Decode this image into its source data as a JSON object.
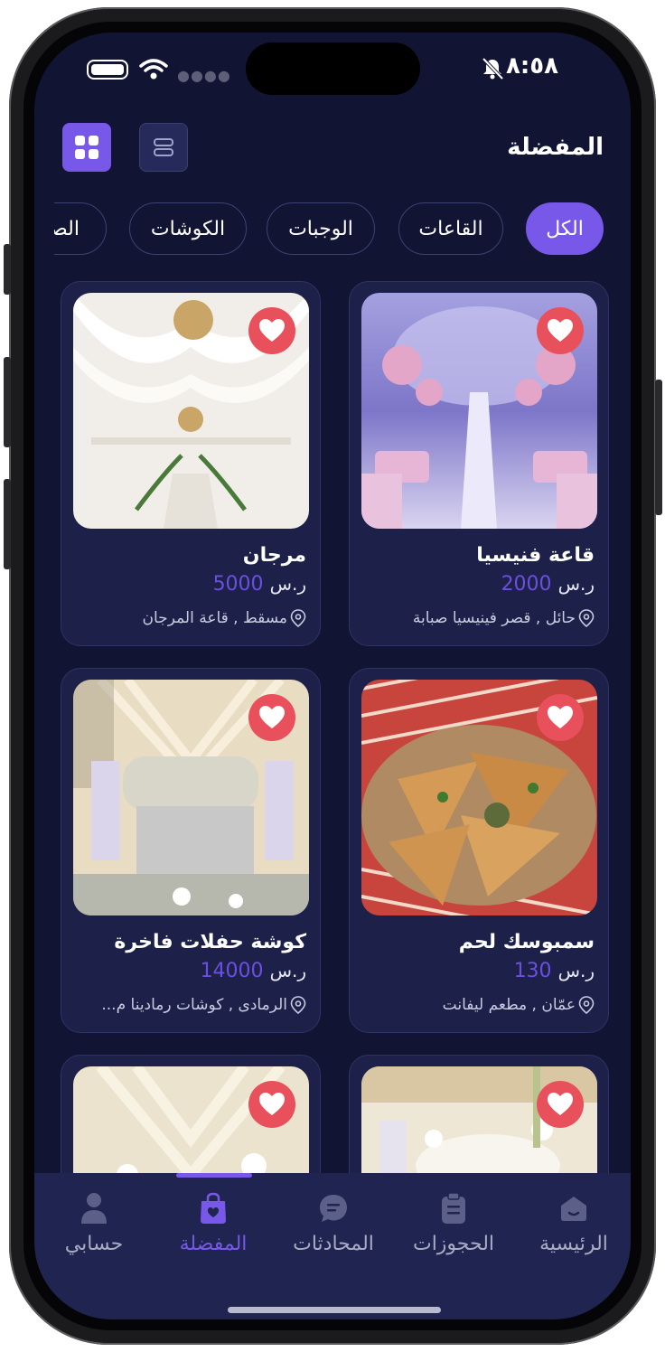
{
  "status": {
    "time": "٨:٥٨"
  },
  "header": {
    "title": "المفضلة"
  },
  "filters": [
    "الكل",
    "القاعات",
    "الوجبات",
    "الكوشات",
    "الصالات"
  ],
  "cards": [
    {
      "title": "قاعة فنيسيا",
      "price": "2000",
      "currency": "ر.س",
      "location": "حائل , قصر فينيسيا صبابة"
    },
    {
      "title": "مرجان",
      "price": "5000",
      "currency": "ر.س",
      "location": "مسقط , قاعة المرجان"
    },
    {
      "title": "سمبوسك لحم",
      "price": "130",
      "currency": "ر.س",
      "location": "عمّان , مطعم ليفانت"
    },
    {
      "title": "كوشة حفلات فاخرة",
      "price": "14000",
      "currency": "ر.س",
      "location": "الرمادى , كوشات رمادينا م..."
    }
  ],
  "nav": {
    "home": "الرئيسية",
    "bookings": "الحجوزات",
    "chats": "المحادثات",
    "favorites": "المفضلة",
    "account": "حسابي"
  },
  "colors": {
    "accent": "#7758e8",
    "background": "#121434",
    "card": "#1d2149",
    "heart": "#e8505b",
    "price": "#6b4fe0"
  }
}
